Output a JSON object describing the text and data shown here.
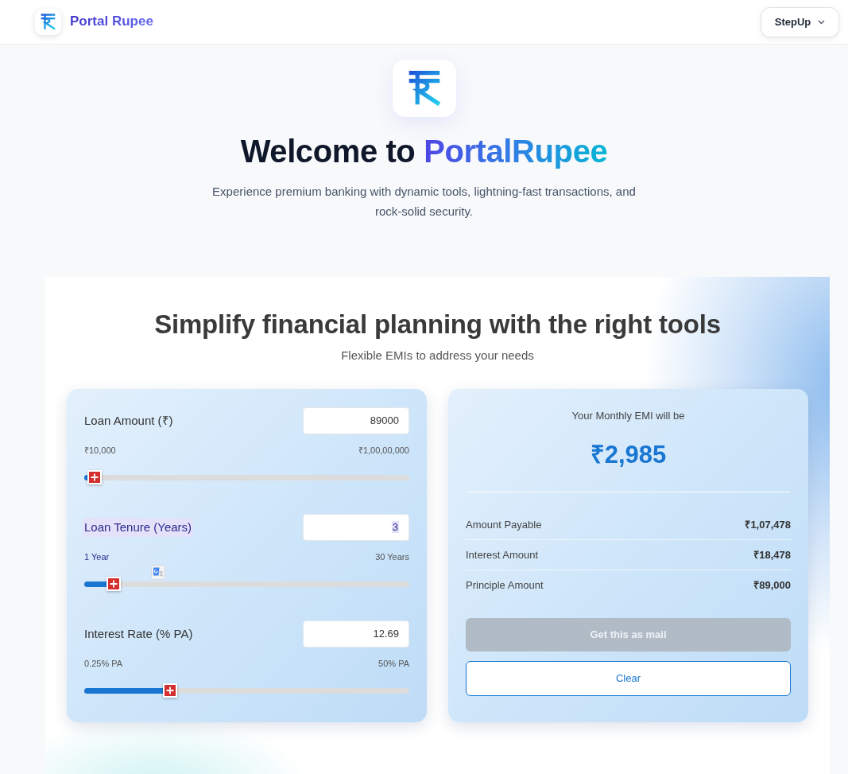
{
  "navbar": {
    "brand": "Portal Rupee",
    "menu_button": "StepUp"
  },
  "hero": {
    "title": "Welcome to",
    "title_highlight": "PortalRupee",
    "subtitle": "Experience premium banking with dynamic tools, lightning-fast transactions, and rock-solid security."
  },
  "emi_calculator": {
    "title": "Simplify financial planning with the right tools",
    "subtitle": "Flexible EMIs to address your needs",
    "inputs": [
      {
        "label": "Loan Amount (₹)",
        "value": "89000",
        "min_label": "₹10,000",
        "max_label": "₹1,00,00,000",
        "level": 0.008,
        "highlighted": false
      },
      {
        "label": "Loan Tenure (Years)",
        "value": "3",
        "min_label": "1 Year",
        "max_label": "30 Years",
        "level": 0.069,
        "highlighted": true
      },
      {
        "label": "Interest Rate (% PA)",
        "value": "12.69",
        "min_label": "0.25% PA",
        "max_label": "50% PA",
        "level": 0.25,
        "highlighted": false
      }
    ],
    "result": {
      "caption": "Your Monthly EMI will be",
      "emi": "₹2,985",
      "rows": [
        {
          "label": "Amount Payable",
          "value": "₹1,07,478"
        },
        {
          "label": "Interest Amount",
          "value": "₹18,478"
        },
        {
          "label": "Principle Amount",
          "value": "₹89,000"
        }
      ],
      "buttons": [
        {
          "label": "Get this as mail",
          "kind": "filled",
          "disabled": true
        },
        {
          "label": "Clear",
          "kind": "outline",
          "disabled": false
        }
      ]
    }
  }
}
